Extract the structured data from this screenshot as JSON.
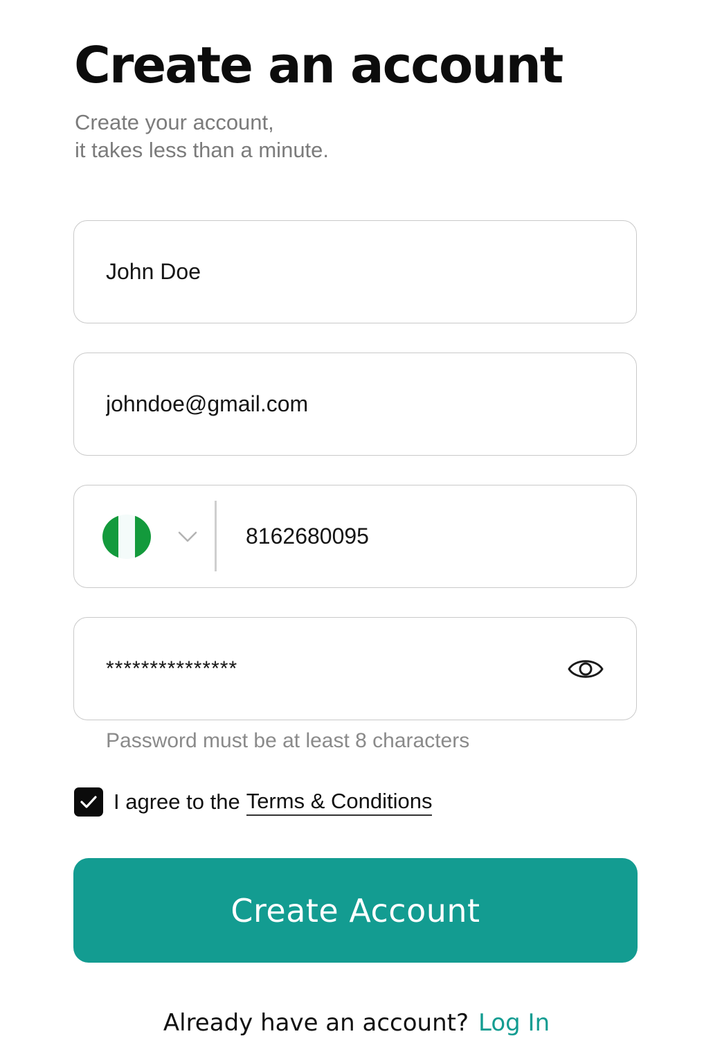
{
  "header": {
    "title": "Create an account",
    "subtitle_line1": "Create your account,",
    "subtitle_line2": "it takes less than a minute."
  },
  "form": {
    "name_value": "John Doe",
    "email_value": "johndoe@gmail.com",
    "phone": {
      "country_flag": "nigeria-flag",
      "flag_colors": [
        "#139a3c",
        "#f4fbfa",
        "#139a3c"
      ],
      "number_value": "8162680095"
    },
    "password_value": "***************",
    "password_hint": "Password must be at least 8 characters",
    "terms": {
      "checked": true,
      "prefix": "I agree to the",
      "link": "Terms & Conditions"
    },
    "submit_label": "Create Account"
  },
  "footer": {
    "prompt": "Already have an account?",
    "login_label": "Log In"
  },
  "colors": {
    "accent": "#139c91",
    "checkbox": "#0b0b0b",
    "border": "#c9c9c9"
  }
}
